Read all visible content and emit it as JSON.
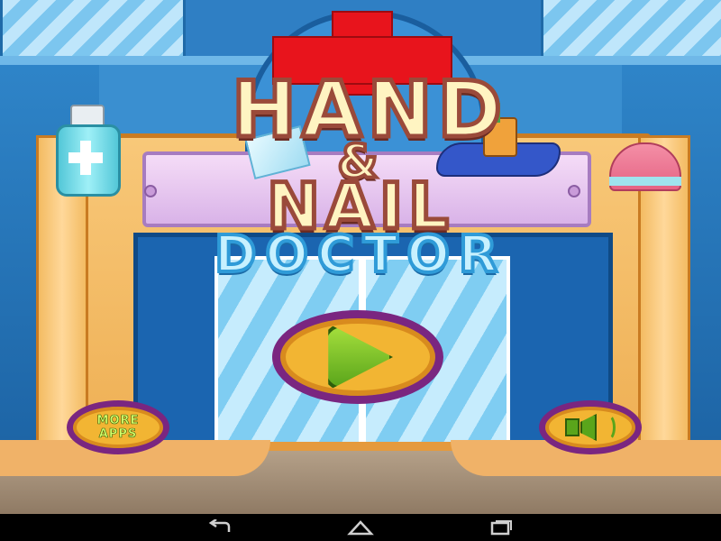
{
  "title": {
    "line1": "HAND",
    "amp": "&",
    "line2": "NAIL",
    "line3": "DOCTOR"
  },
  "buttons": {
    "play": "play",
    "more_apps": "MORE\nAPPS",
    "sound": "sound"
  },
  "icons": {
    "play": "play-icon",
    "sound": "speaker-icon",
    "nav_back": "back-icon",
    "nav_home": "home-icon",
    "nav_recent": "recent-apps-icon"
  },
  "navbar": {
    "back_glyph": "↩",
    "home_glyph": "⌂",
    "recent_glyph": "▭"
  },
  "colors": {
    "button_fill": "#f2b533",
    "button_ring": "#7a2680",
    "play_green": "#5aa51b",
    "cross_red": "#e8141c"
  }
}
